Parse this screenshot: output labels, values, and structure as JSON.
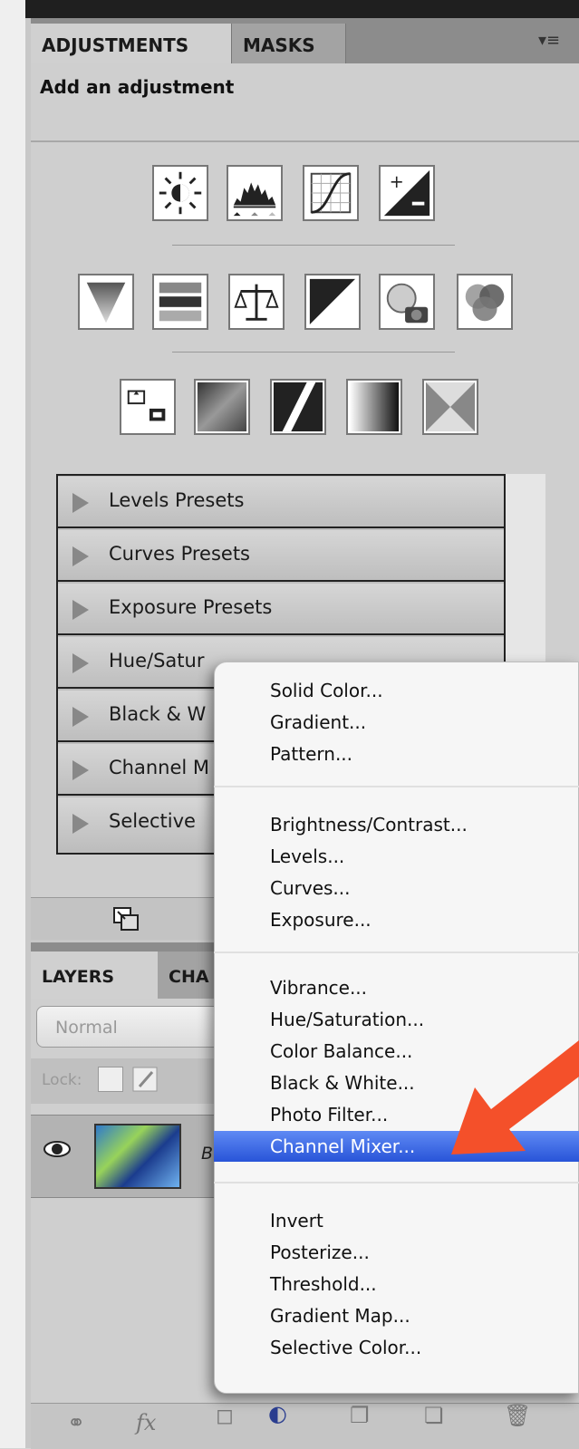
{
  "adjustments_panel": {
    "tabs": [
      {
        "label": "ADJUSTMENTS",
        "active": true
      },
      {
        "label": "MASKS",
        "active": false
      }
    ],
    "header": "Add an adjustment",
    "icon_rows": [
      [
        "brightness-contrast-icon",
        "levels-icon",
        "curves-icon",
        "exposure-icon"
      ],
      [
        "vibrance-icon",
        "hue-saturation-icon",
        "color-balance-icon",
        "black-white-icon",
        "photo-filter-icon",
        "channel-mixer-icon"
      ],
      [
        "invert-icon",
        "posterize-icon",
        "threshold-icon",
        "gradient-map-icon",
        "selective-color-icon"
      ]
    ],
    "presets": [
      "Levels Presets",
      "Curves Presets",
      "Exposure Presets",
      "Hue/Satur",
      "Black & W",
      "Channel M",
      "Selective"
    ]
  },
  "layers_panel": {
    "tabs": [
      {
        "label": "LAYERS",
        "active": true
      },
      {
        "label": "CHA",
        "active": false
      }
    ],
    "blend_mode": "Normal",
    "lock_label": "Lock:",
    "layer": {
      "name": "B",
      "visible": true
    }
  },
  "context_menu": {
    "groups": [
      [
        "Solid Color...",
        "Gradient...",
        "Pattern..."
      ],
      [
        "Brightness/Contrast...",
        "Levels...",
        "Curves...",
        "Exposure..."
      ],
      [
        "Vibrance...",
        "Hue/Saturation...",
        "Color Balance...",
        "Black & White...",
        "Photo Filter...",
        "Channel Mixer..."
      ],
      [
        "Invert",
        "Posterize...",
        "Threshold...",
        "Gradient Map...",
        "Selective Color..."
      ]
    ],
    "highlighted": "Channel Mixer..."
  },
  "colors": {
    "menu_highlight": "#3a68e4",
    "annotation_arrow": "#f4502a"
  }
}
